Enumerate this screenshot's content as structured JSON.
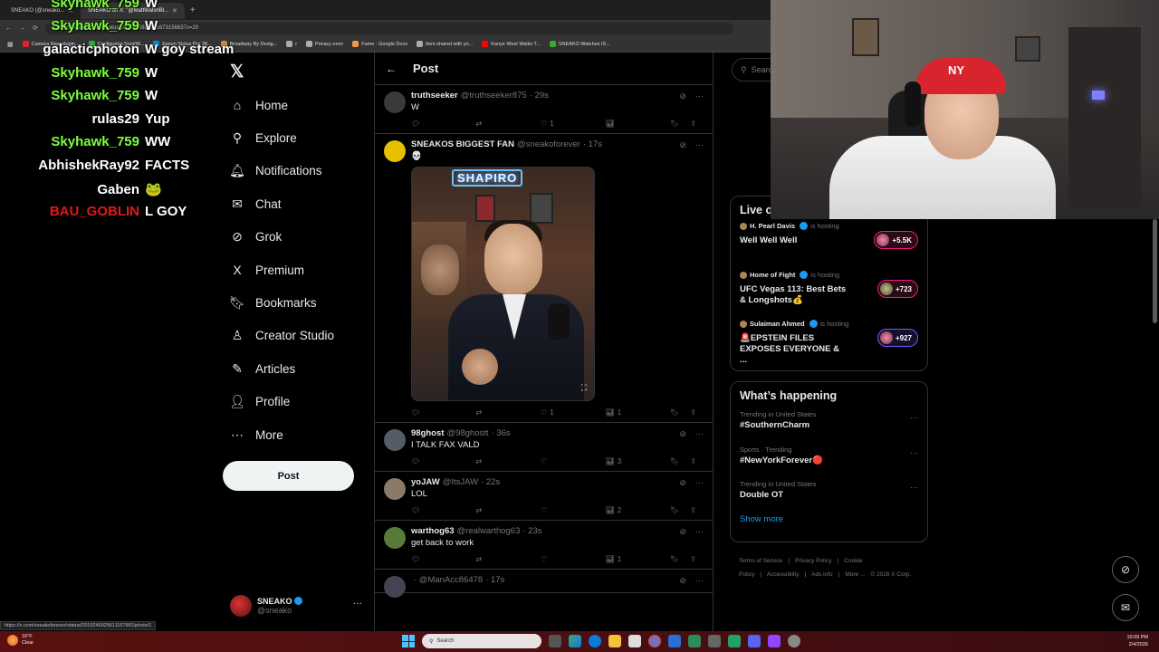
{
  "browser": {
    "tabs": [
      {
        "label": "SNEAKO (@sneako...",
        "active": false
      },
      {
        "label": "SNEAKO on X: \"@MattWalshBl...",
        "active": true
      }
    ],
    "url": "x.com/sneakoforever/status/2019246925611673156637s=20",
    "bookmarks": [
      "Camera Raw plugin...",
      "Configuring Soni/W...",
      "Epson Stylus Pro 38...",
      "Broadway By Desig...",
      "r",
      "Privacy error",
      "Fame - Google Docs",
      "Item shared with yo...",
      "Kanye West Walks T...",
      "SNEAKO Watches IS..."
    ],
    "status_url": "https://x.com/sneakoforever/status/2019246925611167981/photo/1"
  },
  "chat": [
    {
      "user": "Skyhawk_759",
      "msg": "W",
      "color": "#7dff3c"
    },
    {
      "user": "Skyhawk_759",
      "msg": "W",
      "color": "#7dff3c"
    },
    {
      "user": "galacticphoton",
      "msg": "W goy stream",
      "color": "#ffffff"
    },
    {
      "user": "Skyhawk_759",
      "msg": "W",
      "color": "#7dff3c"
    },
    {
      "user": "Skyhawk_759",
      "msg": "W",
      "color": "#7dff3c"
    },
    {
      "user": "rulas29",
      "msg": "Yup",
      "color": "#ffffff"
    },
    {
      "user": "Skyhawk_759",
      "msg": "WW",
      "color": "#7dff3c"
    },
    {
      "user": "AbhishekRay92",
      "msg": "FACTS",
      "color": "#ffffff"
    },
    {
      "user": "Gaben",
      "msg": "🐸",
      "color": "#ffffff"
    },
    {
      "user": "BAU_GOBLIN",
      "msg": "L GOY",
      "color": "#e01818"
    }
  ],
  "nav": {
    "items": [
      {
        "label": "Home",
        "icon": "⌂"
      },
      {
        "label": "Explore",
        "icon": "⚲"
      },
      {
        "label": "Notifications",
        "icon": "🔔︎"
      },
      {
        "label": "Chat",
        "icon": "✉"
      },
      {
        "label": "Grok",
        "icon": "⊘"
      },
      {
        "label": "Premium",
        "icon": "X"
      },
      {
        "label": "Bookmarks",
        "icon": "🔖︎"
      },
      {
        "label": "Creator Studio",
        "icon": "♙"
      },
      {
        "label": "Articles",
        "icon": "✎"
      },
      {
        "label": "Profile",
        "icon": "👤︎"
      },
      {
        "label": "More",
        "icon": "⋯"
      }
    ],
    "post_label": "Post",
    "account": {
      "name": "SNEAKO",
      "handle": "@sneako"
    }
  },
  "main": {
    "title": "Post",
    "tweets": [
      {
        "name": "truthseeker",
        "handle": "@truthseeker875",
        "time": "· 29s",
        "text": "W",
        "likes": "1",
        "views": "",
        "av": "#3a3a3a"
      },
      {
        "name": "SNEAKOS BIGGEST FAN",
        "handle": "@sneakoforever",
        "time": "· 17s",
        "text": "💀",
        "likes": "1",
        "views": "1",
        "av": "#e5c100",
        "media": true
      },
      {
        "name": "98ghost",
        "handle": "@98ghostt",
        "time": "· 36s",
        "text": "I TALK FAX VALD",
        "likes": "",
        "views": "3",
        "av": "#555c66"
      },
      {
        "name": "yoJAW",
        "handle": "@ItsJAW",
        "time": "· 22s",
        "text": "LOL",
        "likes": "",
        "views": "2",
        "av": "#8a7a6a"
      },
      {
        "name": "warthog63",
        "handle": "@realwarthog63",
        "time": "· 23s",
        "text": "get back to work",
        "likes": "",
        "views": "1",
        "av": "#5a7a3a"
      },
      {
        "name": "",
        "handle": "· @ManAcc86478",
        "time": "· 17s",
        "text": "",
        "likes": "",
        "views": "",
        "av": "#445"
      }
    ],
    "media_sign": "SHAPIRO"
  },
  "sidebar": {
    "search_placeholder": "Search",
    "live_title": "Live on X",
    "live": [
      {
        "host": "H. Pearl Davis",
        "sub": "is hosting",
        "title": "Well Well Well",
        "count": "+5.5K",
        "pill": "pink"
      },
      {
        "host": "Home of Fight",
        "sub": "is hosting",
        "title": "UFC Vegas 113: Best Bets & Longshots💰",
        "count": "+723",
        "pill": "pink"
      },
      {
        "host": "Sulaiman Ahmed",
        "sub": "is hosting",
        "title": "🚨EPSTEIN FILES EXPOSES EVERYONE & ...",
        "count": "+927",
        "pill": "purple"
      }
    ],
    "happening_title": "What’s happening",
    "trends": [
      {
        "context": "Trending in United States",
        "name": "#SouthernCharm"
      },
      {
        "context": "Sports · Trending",
        "name": "#NewYorkForever🔴"
      },
      {
        "context": "Trending in United States",
        "name": "Double OT"
      }
    ],
    "show_more": "Show more",
    "footer": [
      "Terms of Service",
      "|",
      "Privacy Policy",
      "|",
      "Cookie Policy",
      "|",
      "Accessibility",
      "|",
      "Ads info",
      "|",
      "More ...",
      "© 2026 X Corp."
    ]
  },
  "taskbar": {
    "weather_temp": "16°F",
    "weather_desc": "Clear",
    "search": "Search",
    "time": "10:09 PM",
    "date": "2/4/2026"
  }
}
